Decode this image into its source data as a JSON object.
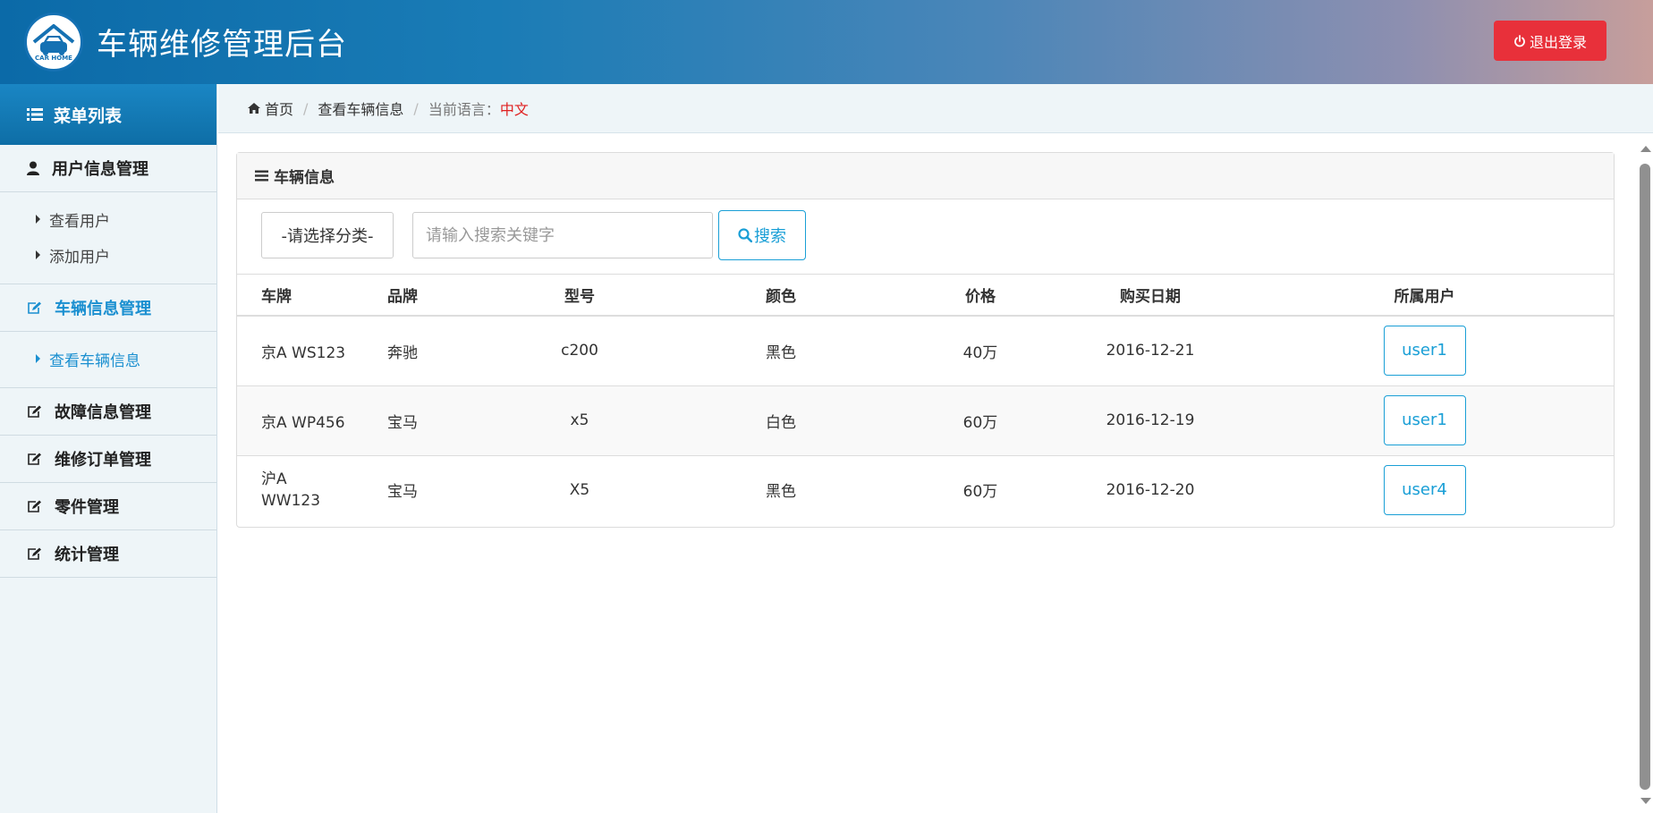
{
  "header": {
    "logo_text": "CAR HOME",
    "title": "车辆维修管理后台",
    "logout_label": "退出登录"
  },
  "sidebar": {
    "title": "菜单列表",
    "groups": [
      {
        "label": "用户信息管理",
        "icon": "user-icon",
        "items": [
          {
            "label": "查看用户"
          },
          {
            "label": "添加用户"
          }
        ]
      },
      {
        "label": "车辆信息管理",
        "icon": "edit-icon",
        "items": [
          {
            "label": "查看车辆信息"
          }
        ]
      },
      {
        "label": "故障信息管理",
        "icon": "edit-icon"
      },
      {
        "label": "维修订单管理",
        "icon": "edit-icon"
      },
      {
        "label": "零件管理",
        "icon": "edit-icon"
      },
      {
        "label": "统计管理",
        "icon": "edit-icon"
      }
    ]
  },
  "breadcrumb": {
    "home": "首页",
    "current": "查看车辆信息",
    "lang_label": "当前语言：",
    "lang_value": "中文"
  },
  "panel": {
    "title": "车辆信息",
    "category_select": "-请选择分类-",
    "search_placeholder": "请输入搜索关键字",
    "search_label": "搜索"
  },
  "table": {
    "headers": [
      "车牌",
      "品牌",
      "型号",
      "颜色",
      "价格",
      "购买日期",
      "所属用户"
    ],
    "rows": [
      {
        "plate": "京A WS123",
        "brand": "奔驰",
        "model": "c200",
        "color": "黑色",
        "price": "40万",
        "date": "2016-12-21",
        "user": "user1"
      },
      {
        "plate": "京A WP456",
        "brand": "宝马",
        "model": "x5",
        "color": "白色",
        "price": "60万",
        "date": "2016-12-19",
        "user": "user1"
      },
      {
        "plate": "沪A WW123",
        "brand": "宝马",
        "model": "X5",
        "color": "黑色",
        "price": "60万",
        "date": "2016-12-20",
        "user": "user4"
      }
    ]
  },
  "colors": {
    "accent": "#1a9fd6",
    "danger": "#e8303a",
    "active_menu": "#1a8fd0"
  }
}
